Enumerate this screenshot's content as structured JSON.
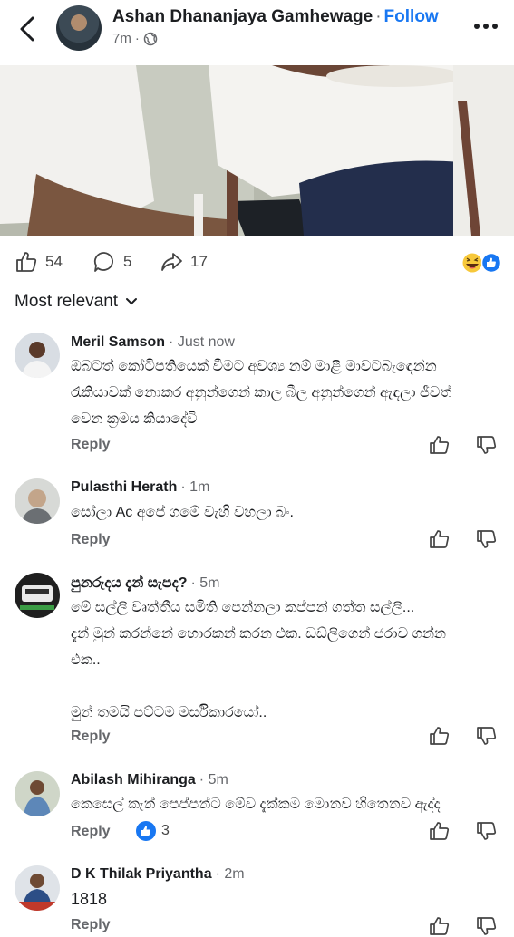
{
  "header": {
    "author": "Ashan Dhananjaya Gamhewage",
    "separator": "·",
    "follow_label": "Follow",
    "time": "7m",
    "audience_icon": "globe-icon"
  },
  "post_stats": {
    "likes": "54",
    "comments": "5",
    "shares": "17",
    "reaction_icons": [
      "haha-emoji-icon",
      "like-badge-icon"
    ]
  },
  "sort_label": "Most relevant",
  "comments": [
    {
      "name": "Meril Samson",
      "time": "Just now",
      "text": "ඔබටත් කෝටිපතියෙක් වීමට අවශ්‍ය නම් මාළී මාවටබැඳෙන්න\nරැකියාවක් නොකර අනුන්ගෙන් කාල බීල අනුන්ගෙන් ඇඳලා ජීවත්\nවෙන ක්‍රමය කියාදේවි",
      "reply": "Reply"
    },
    {
      "name": "Pulasthi Herath",
      "time": "1m",
      "text": "සෝලා Ac අපේ ගමේ වැහි වහලා බං.",
      "reply": "Reply"
    },
    {
      "name": "පුනරුදය දැන් සැපද?",
      "time": "5m",
      "text": "මේ සල්ලි වෘත්තීය සමිති පෙන්නලා කප්පන් ගත්ත සල්ලි...\nදැන් මුන් කරන්නේ හොරකන් කරන එක. ඩඩ්ලිගෙන් ජරාව ගන්න\nඑක..\n\nමුන් තමයි පට්ටම මර්සිකාරයෝ..",
      "reply": "Reply"
    },
    {
      "name": "Abilash Mihiranga",
      "time": "5m",
      "text": "කෙසෙල් කැන් පෙප්පන්ට මේව දැක්කම මොනව හිතෙනව ඇද්ද",
      "reply": "Reply",
      "like_count": "3"
    },
    {
      "name": "D K Thilak Priyantha",
      "time": "2m",
      "text": "1818",
      "reply": "Reply"
    }
  ]
}
